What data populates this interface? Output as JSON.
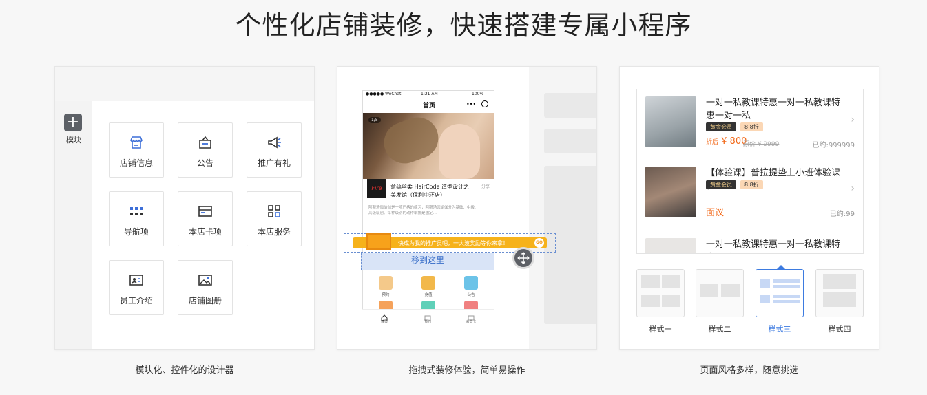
{
  "headline": "个性化店铺装修，快速搭建专属小程序",
  "panel1": {
    "add_label": "模块",
    "tiles": [
      {
        "label": "店铺信息",
        "icon": "store-icon"
      },
      {
        "label": "公告",
        "icon": "notice-icon"
      },
      {
        "label": "推广有礼",
        "icon": "megaphone-icon"
      },
      {
        "label": "导航项",
        "icon": "grid-dots-icon"
      },
      {
        "label": "本店卡项",
        "icon": "card-icon"
      },
      {
        "label": "本店服务",
        "icon": "apps-icon"
      },
      {
        "label": "员工介绍",
        "icon": "id-card-icon"
      },
      {
        "label": "店铺图册",
        "icon": "picture-icon"
      }
    ],
    "caption": "模块化、控件化的设计器"
  },
  "panel2": {
    "status": {
      "carrier": "●●●●● WeChat",
      "time": "1:21 AM",
      "battery": "100%"
    },
    "nav_title": "首页",
    "pager": "1/5",
    "store_logo": "Fire",
    "store_name": "意蕴丝柔 HairCode 造型设计之美发馆（保利中环店）",
    "share": "分享",
    "store_desc": "阿斯汤伽瑜伽是一项严格的练习，阿斯汤伽瑜伽分为基础、中级、高级级别。每种级别的动作编排是固定…",
    "banner_text": "快成为我的推广员吧，一大波奖励等你来拿！",
    "banner_go": "GO",
    "drop_text": "移到这里",
    "quick_icons": [
      "预约",
      "充值",
      "公告"
    ],
    "tabs": [
      "首页",
      "预约",
      "会员卡"
    ],
    "caption": "拖拽式装修体验，简单易操作"
  },
  "panel3": {
    "courses": [
      {
        "title": "一对一私教课特惠一对一私教课特惠一对一私",
        "badge": "黄金会员",
        "discount": "8.8折",
        "price_prefix": "折后",
        "price": "¥ 800",
        "old_price": "原价 ¥ 9999",
        "sold": "已约:999999"
      },
      {
        "title": "【体验课】普拉提垫上小班体验课程",
        "badge": "黄金会员",
        "discount": "8.8折",
        "price": "面议",
        "sold": "已约:99"
      },
      {
        "title": "一对一私教课特惠一对一私教课特惠一对一私",
        "badge": "",
        "discount": "",
        "price": "",
        "sold": ""
      }
    ],
    "styles": [
      "样式一",
      "样式二",
      "样式三",
      "样式四"
    ],
    "selected_style": "样式三",
    "caption": "页面风格多样，随意挑选"
  }
}
